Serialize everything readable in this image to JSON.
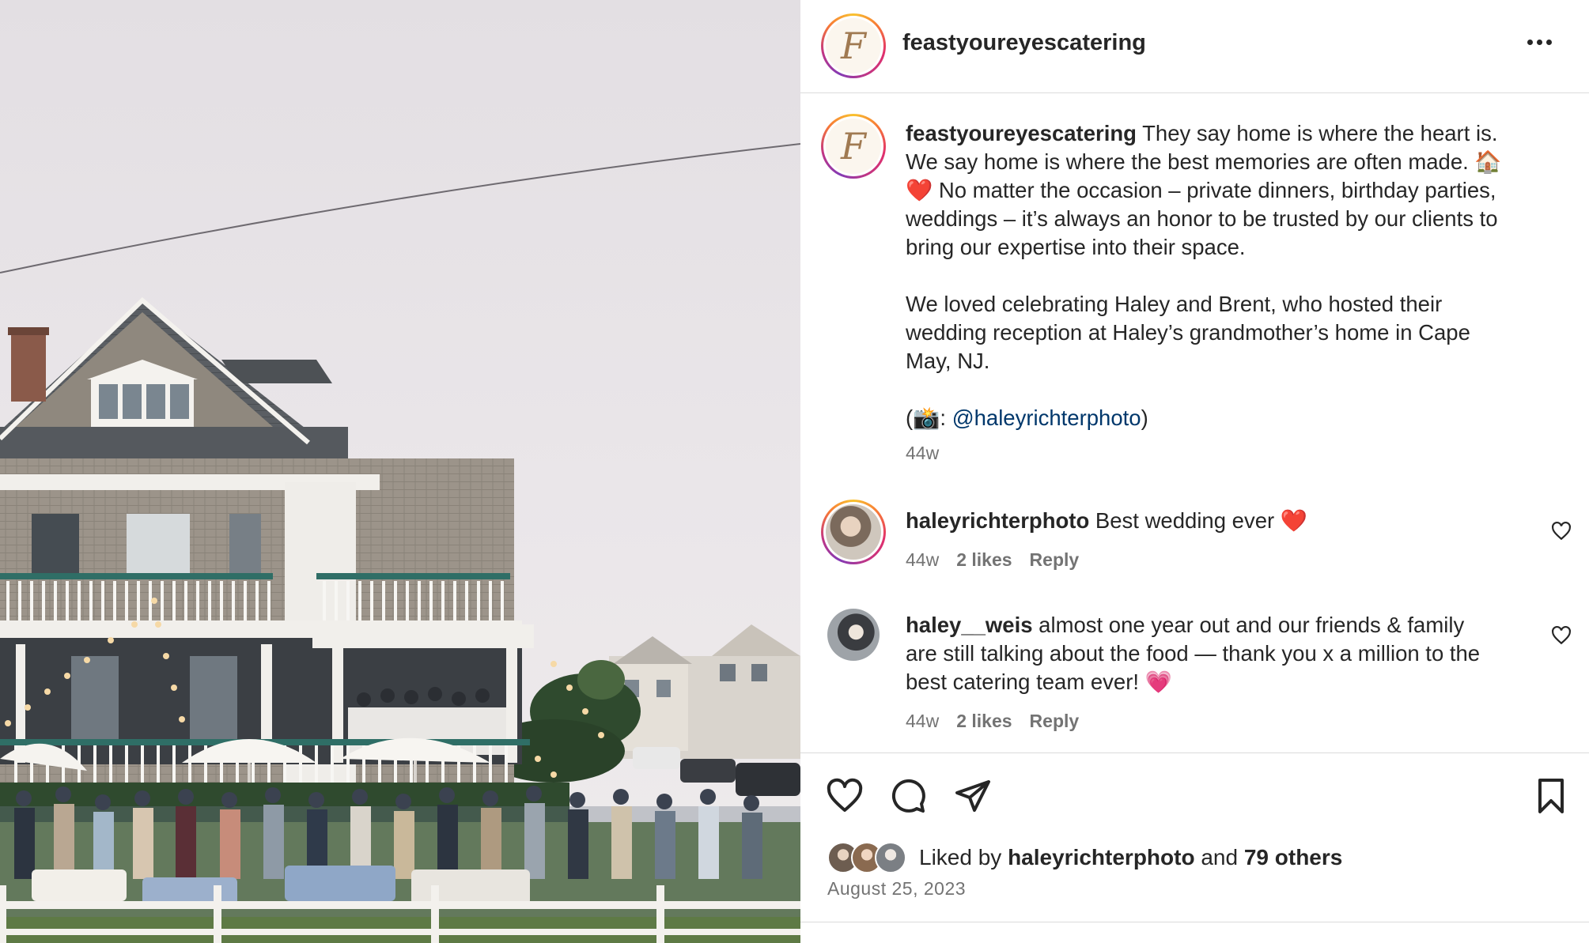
{
  "photo": {
    "alt": "Wedding reception outside a shingled beach house"
  },
  "post": {
    "username": "feastyoureyescatering",
    "avatar_letter": "F",
    "more_icon": "more-horizontal-icon",
    "caption": {
      "username": "feastyoureyescatering",
      "line1": "They say home is where the heart is.",
      "line2": "We say home is where the best memories are often made. 🏠",
      "line3": "❤️ No matter the occasion – private dinners, birthday parties,",
      "line4": "weddings – it’s always an honor to be trusted by our clients to",
      "line5": "bring our expertise into their space.",
      "line6": "We loved celebrating Haley and Brent, who hosted their",
      "line7": "wedding reception at Haley’s grandmother’s home in Cape",
      "line8": "May, NJ.",
      "credit_open": "(📸: ",
      "credit_mention": "@haleyrichterphoto",
      "credit_close": ")",
      "age": "44w"
    },
    "comments": [
      {
        "username": "haleyrichterphoto",
        "text": "Best wedding ever ❤️",
        "age": "44w",
        "likes": "2 likes",
        "reply": "Reply"
      },
      {
        "username": "haley__weis",
        "line1": "almost one year out and our friends & family",
        "line2": "are still talking about the food — thank you x a million to the",
        "line3": "best catering team ever! 💗",
        "age": "44w",
        "likes": "2 likes",
        "reply": "Reply"
      }
    ],
    "actions": {
      "like_icon": "heart-icon",
      "comment_icon": "comment-icon",
      "share_icon": "send-icon",
      "save_icon": "bookmark-icon"
    },
    "liked_by": {
      "prefix": "Liked by",
      "user": "haleyrichterphoto",
      "and": "and",
      "others": "79 others"
    },
    "date": "August 25, 2023"
  }
}
